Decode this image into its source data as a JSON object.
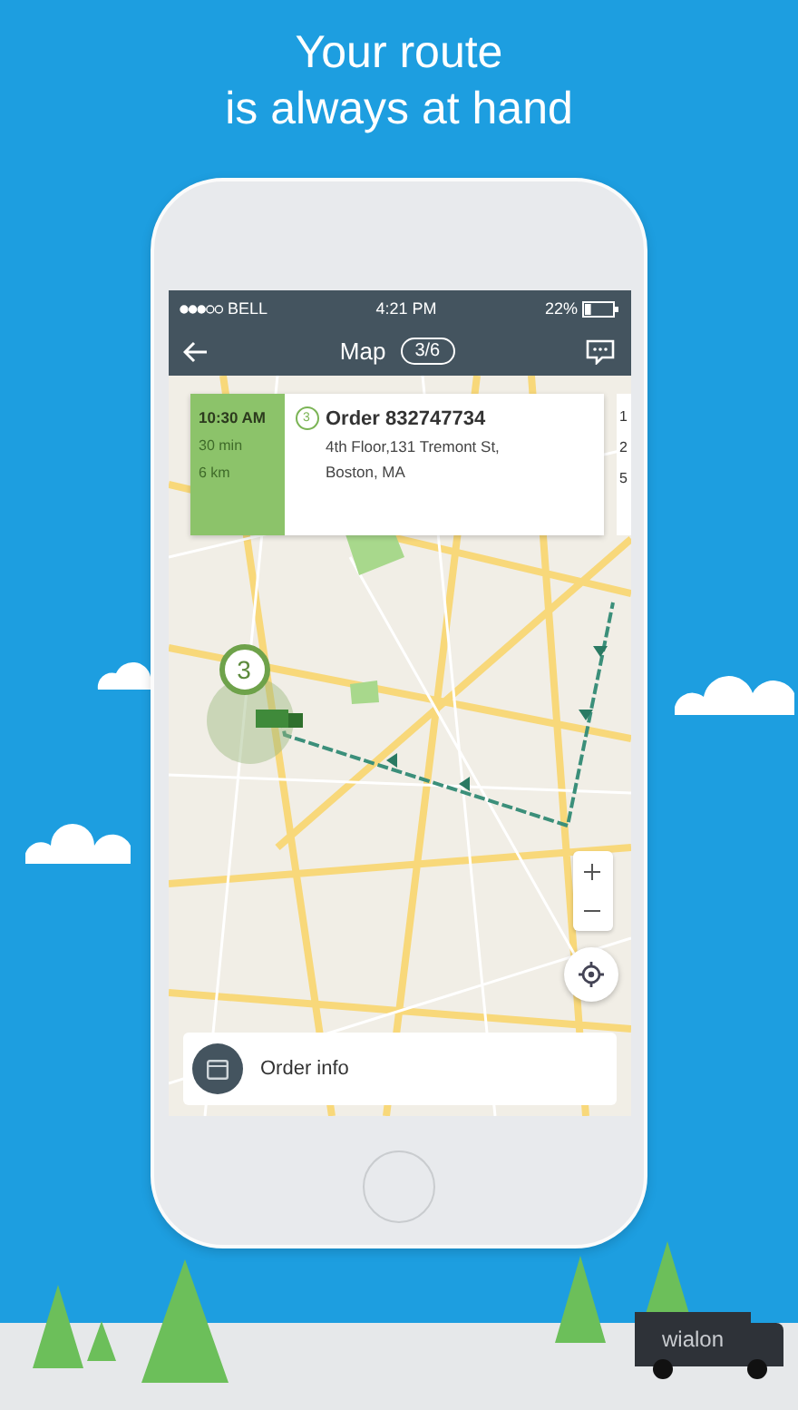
{
  "headline": [
    "Your route",
    "is always at hand"
  ],
  "status_bar": {
    "carrier": "BELL",
    "time": "4:21 PM",
    "battery": "22%"
  },
  "nav_bar": {
    "title": "Map",
    "counter": "3/6"
  },
  "order_card": {
    "time": "10:30 AM",
    "duration": "30 min",
    "distance": "6 km",
    "pin_label": "3",
    "title": "Order 832747734",
    "address": [
      "4th Floor,131 Tremont St,",
      "Boston, MA"
    ]
  },
  "next_card": [
    "1",
    "2",
    "5"
  ],
  "map": {
    "marker_label": "3"
  },
  "order_info": {
    "label": "Order info"
  },
  "logo": "wialon"
}
